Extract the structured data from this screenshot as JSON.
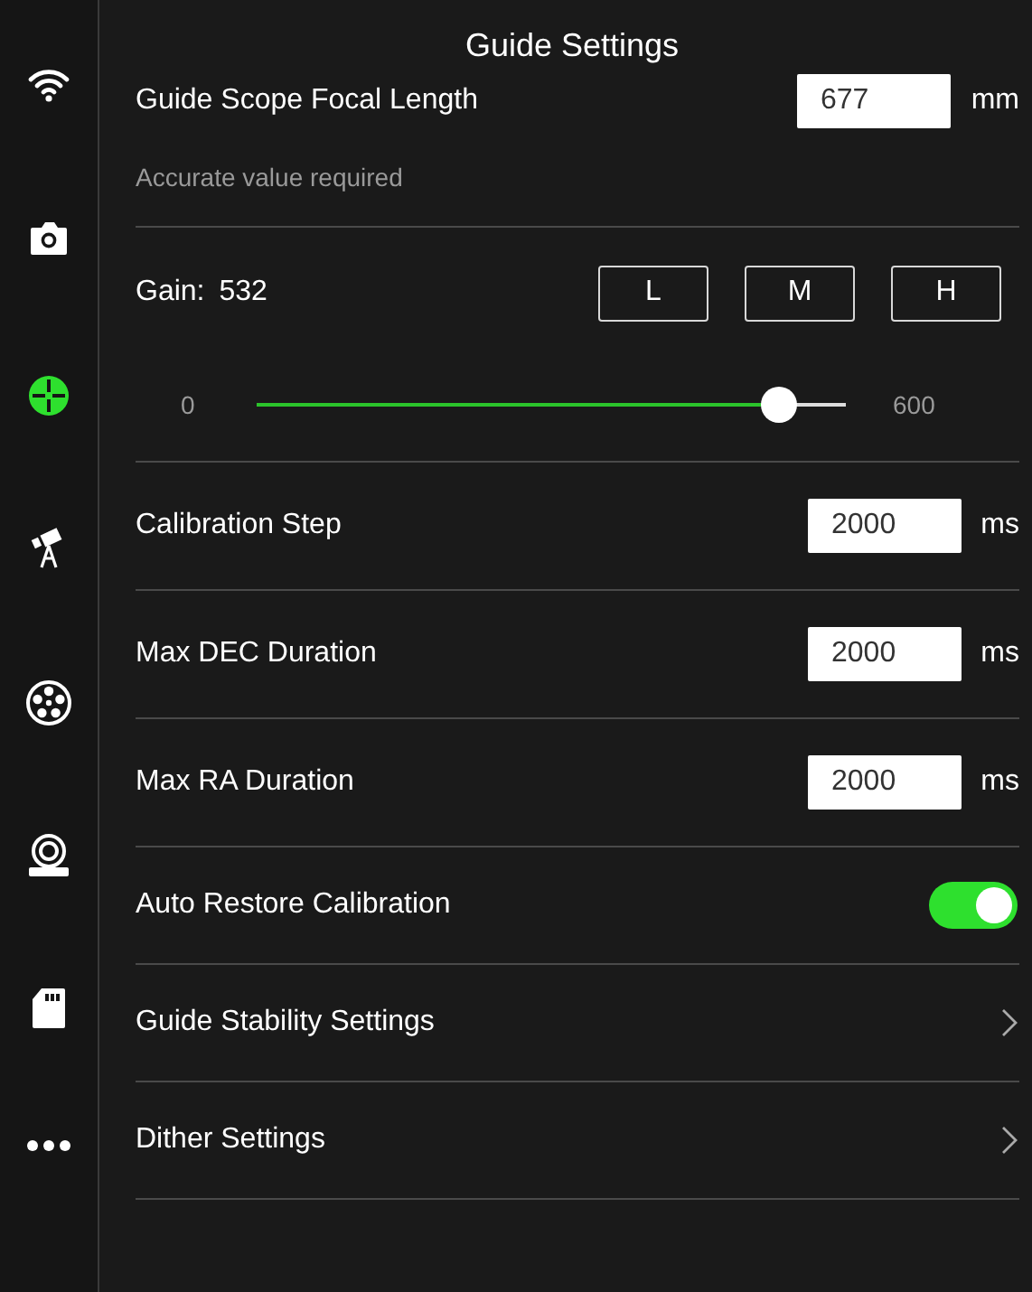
{
  "sidebar": {
    "items": [
      {
        "selected": false
      },
      {
        "selected": false
      },
      {
        "selected": true
      },
      {
        "selected": false
      },
      {
        "selected": false
      },
      {
        "selected": false
      },
      {
        "selected": false
      },
      {
        "selected": false
      }
    ]
  },
  "title": "Guide Settings",
  "focal_length": {
    "label": "Guide Scope Focal Length",
    "value": "677",
    "unit": "mm",
    "hint": "Accurate value required"
  },
  "gain": {
    "label": "Gain:",
    "value": "532",
    "presets": [
      {
        "label": "L",
        "selected": false
      },
      {
        "label": "M",
        "selected": false
      },
      {
        "label": "H",
        "selected": false
      }
    ],
    "min": "0",
    "max": "600",
    "level": 0.887
  },
  "rows": [
    {
      "kind": "input",
      "label": "Calibration Step",
      "value": "2000",
      "unit": "ms"
    },
    {
      "kind": "input",
      "label": "Max DEC Duration",
      "value": "2000",
      "unit": "ms"
    },
    {
      "kind": "input",
      "label": "Max RA Duration",
      "value": "2000",
      "unit": "ms"
    },
    {
      "kind": "toggle",
      "label": "Auto Restore Calibration",
      "on": true
    },
    {
      "kind": "link",
      "label": "Guide Stability Settings"
    },
    {
      "kind": "link",
      "label": "Dither Settings"
    }
  ]
}
